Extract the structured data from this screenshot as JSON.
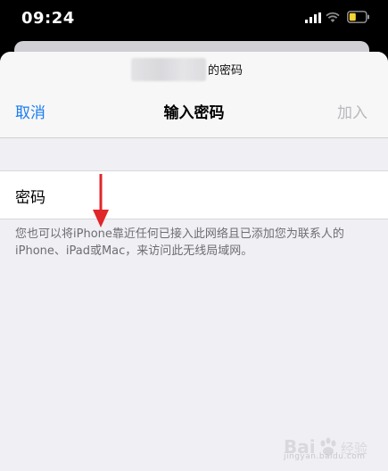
{
  "status_bar": {
    "time": "09:24",
    "icons": [
      "signal-icon",
      "wifi-icon",
      "battery-icon"
    ],
    "battery_color": "#f5d235"
  },
  "sheet": {
    "subtitle": "的密码",
    "cancel_label": "取消",
    "title": "输入密码",
    "join_label": "加入"
  },
  "password_field": {
    "label": "密码",
    "value": ""
  },
  "hint_text": "您也可以将iPhone靠近任何已接入此网络且已添加您为联系人的iPhone、iPad或Mac，来访问此无线局域网。",
  "colors": {
    "accent": "#1a7cf1",
    "disabled": "#b8b8bd",
    "annotation_arrow": "#e0262a"
  },
  "watermark": {
    "logo": "Baidu 经验",
    "text": "jingyan.baidu.com"
  }
}
